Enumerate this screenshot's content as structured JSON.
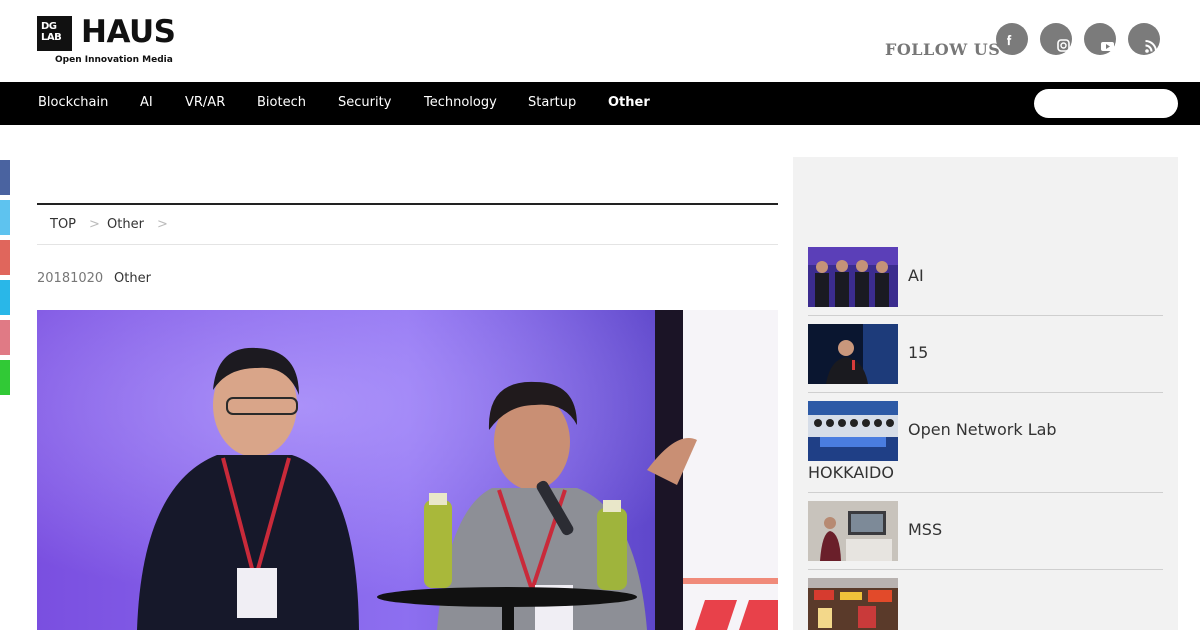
{
  "header": {
    "logo_mark_line1": "DG",
    "logo_mark_line2": "LAB",
    "logo_word": "HAUS",
    "logo_tagline": "Open Innovation Media",
    "follow_label": "FOLLOW US",
    "social": [
      {
        "icon": "facebook-icon"
      },
      {
        "icon": "instagram-icon"
      },
      {
        "icon": "youtube-icon"
      },
      {
        "icon": "rss-icon"
      }
    ]
  },
  "nav": {
    "items": [
      {
        "label": "Blockchain"
      },
      {
        "label": "AI"
      },
      {
        "label": "VR/AR"
      },
      {
        "label": "Biotech"
      },
      {
        "label": "Security"
      },
      {
        "label": "Technology"
      },
      {
        "label": "Startup"
      },
      {
        "label": "Other",
        "active": true
      }
    ],
    "search_placeholder": ""
  },
  "share_colors": [
    "#4a63a0",
    "#5ec3ef",
    "#e0665c",
    "#29b7e8",
    "#e07a85",
    "#31c936"
  ],
  "breadcrumb": {
    "items": [
      "TOP",
      "Other"
    ],
    "separator": ">"
  },
  "article": {
    "date": "20181020",
    "category": "Other"
  },
  "sidebar": {
    "items": [
      {
        "title": "AI"
      },
      {
        "title": "15"
      },
      {
        "title": "Open Network Lab",
        "title_line2": "HOKKAIDO"
      },
      {
        "title": "MSS"
      },
      {
        "title": ""
      }
    ]
  },
  "colors": {
    "nav_bg": "#000000",
    "sidebar_bg": "#f2f2f2",
    "social_icon_bg": "#7b7b7b"
  }
}
